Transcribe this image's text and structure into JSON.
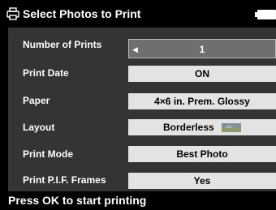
{
  "title": "Select Photos to Print",
  "settings": [
    {
      "label": "Number of Prints",
      "value": "1"
    },
    {
      "label": "Print Date",
      "value": "ON"
    },
    {
      "label": "Paper",
      "value": "4×6 in. Prem. Glossy"
    },
    {
      "label": "Layout",
      "value": "Borderless"
    },
    {
      "label": "Print Mode",
      "value": "Best Photo"
    },
    {
      "label": "Print P.I.F. Frames",
      "value": "Yes"
    }
  ],
  "status": "Press OK to start printing",
  "icons": [
    "print-icon",
    "battery-icon",
    "left-arrow-icon",
    "borderless-thumbnail-icon"
  ],
  "colors": {
    "background": "#000000",
    "panel": "#343434",
    "value_bg": "#e3e3e3",
    "selected_bg": "#6f6f6f"
  }
}
